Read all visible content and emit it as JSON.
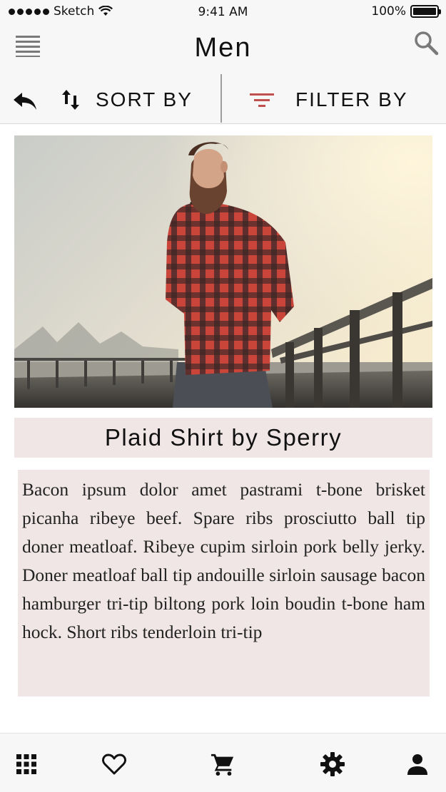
{
  "status_bar": {
    "carrier": "Sketch",
    "time": "9:41 AM",
    "battery": "100%"
  },
  "nav": {
    "title": "Men",
    "menu_icon": "hamburger-menu-icon",
    "search_icon": "search-icon"
  },
  "toolbar": {
    "back_icon": "reply-arrow-icon",
    "sort_icon": "sort-arrows-icon",
    "sort_label": "SORT BY",
    "filter_icon": "filter-lines-icon",
    "filter_label": "FILTER BY",
    "filter_icon_color": "#c0504d"
  },
  "product": {
    "image_icon": "product-photo",
    "title": "Plaid Shirt by Sperry",
    "description": "Bacon ipsum dolor amet pastrami t-bone brisket picanha ribeye beef. Spare ribs prosciutto ball tip doner meatloaf. Ribeye cupim sirloin pork belly jerky. Doner meatloaf ball tip andouille sirloin sausage bacon hamburger tri-tip biltong pork loin boudin t-bone ham hock. Short ribs tenderloin tri-tip"
  },
  "tab_bar": {
    "items": [
      {
        "icon": "grid-apps-icon"
      },
      {
        "icon": "heart-icon"
      },
      {
        "icon": "shopping-cart-icon"
      },
      {
        "icon": "gear-icon"
      },
      {
        "icon": "person-icon"
      }
    ]
  },
  "colors": {
    "bar_background": "#f7f7f7",
    "card_background": "#f0e6e6",
    "accent": "#c0504d"
  }
}
